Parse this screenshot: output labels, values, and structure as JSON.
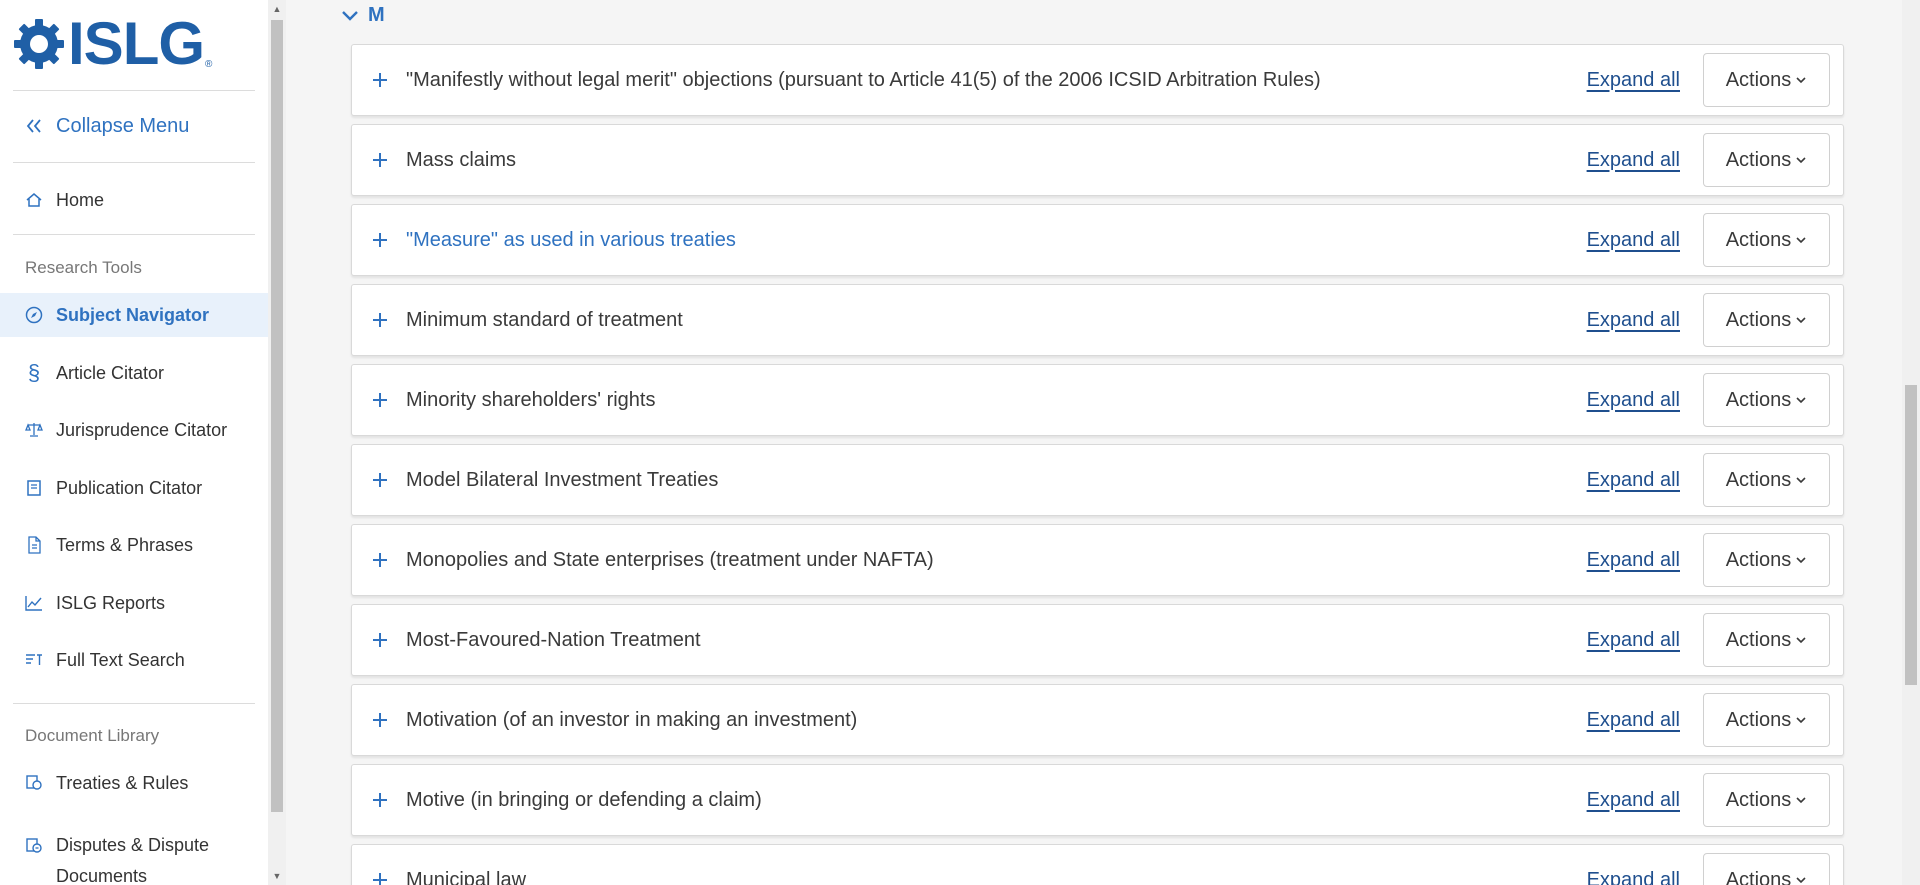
{
  "brand": {
    "name": "ISLG",
    "reg": "®"
  },
  "sidebar": {
    "collapse_label": "Collapse Menu",
    "home_label": "Home",
    "research_heading": "Research Tools",
    "research_items": [
      {
        "label": "Subject Navigator",
        "icon": "compass-icon",
        "active": true
      },
      {
        "label": "Article Citator",
        "icon": "section-sign-icon"
      },
      {
        "label": "Jurisprudence Citator",
        "icon": "scales-icon"
      },
      {
        "label": "Publication Citator",
        "icon": "book-icon"
      },
      {
        "label": "Terms & Phrases",
        "icon": "document-icon"
      },
      {
        "label": "ISLG Reports",
        "icon": "chart-line-icon"
      },
      {
        "label": "Full Text Search",
        "icon": "text-search-icon"
      }
    ],
    "library_heading": "Document Library",
    "library_items": [
      {
        "label": "Treaties & Rules",
        "icon": "treaties-icon"
      },
      {
        "label": "Disputes & Dispute Documents",
        "icon": "disputes-icon"
      }
    ]
  },
  "main": {
    "letter": "M",
    "expand_label": "Expand all",
    "actions_label": "Actions",
    "rows": [
      {
        "title": "\"Manifestly without legal merit\" objections (pursuant to Article 41(5) of the 2006 ICSID Arbitration Rules)"
      },
      {
        "title": "Mass claims"
      },
      {
        "title": "\"Measure\" as used in various treaties",
        "link": true
      },
      {
        "title": "Minimum standard of treatment"
      },
      {
        "title": "Minority shareholders' rights"
      },
      {
        "title": "Model Bilateral Investment Treaties"
      },
      {
        "title": "Monopolies and State enterprises (treatment under NAFTA)"
      },
      {
        "title": "Most-Favoured-Nation Treatment"
      },
      {
        "title": "Motivation (of an investor in making an investment)"
      },
      {
        "title": "Motive (in bringing or defending a claim)"
      },
      {
        "title": "Municipal law"
      }
    ]
  },
  "colors": {
    "accent": "#2f72c0",
    "link_dark": "#1f4f8e",
    "active_bg": "#e8f1fb"
  }
}
